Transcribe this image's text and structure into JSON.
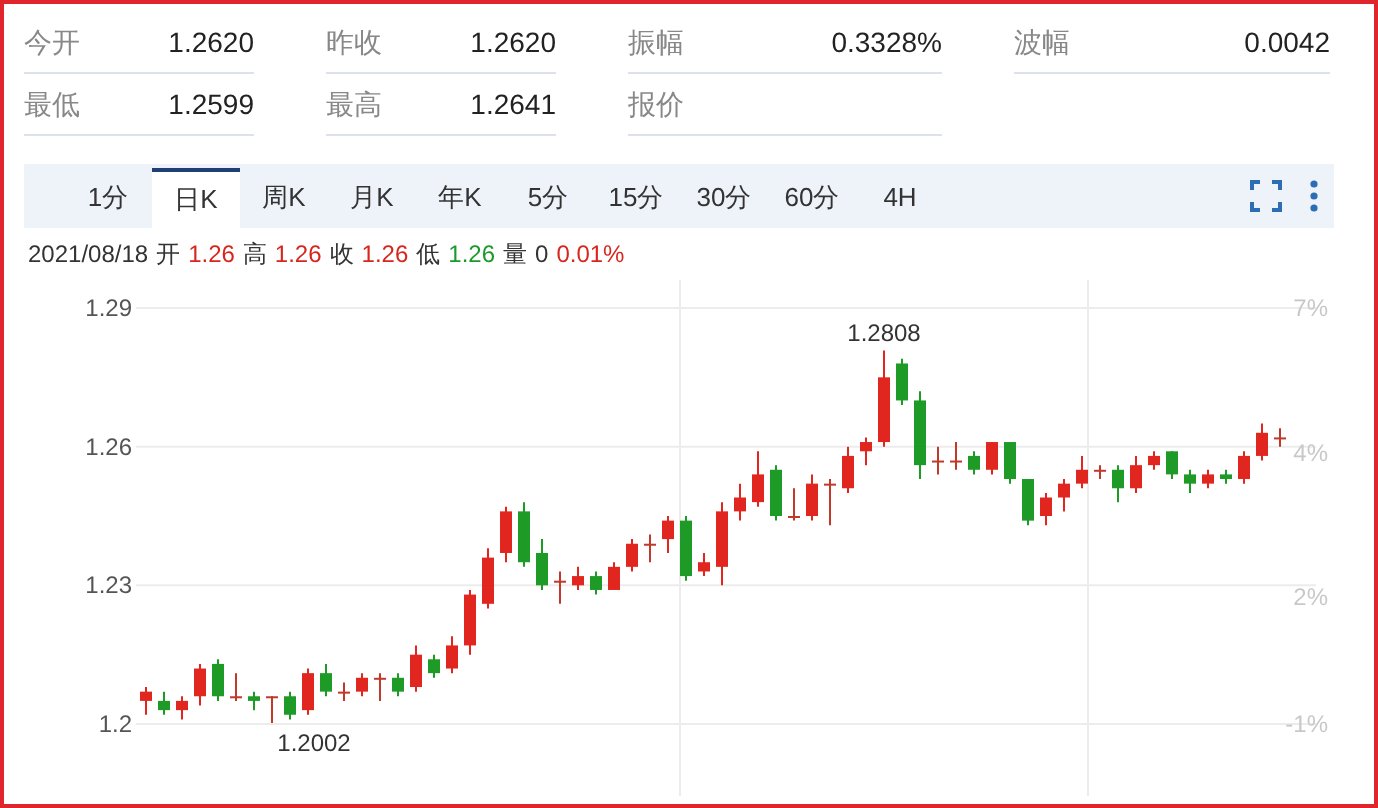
{
  "stats": [
    {
      "label": "今开",
      "value": "1.2620"
    },
    {
      "label": "昨收",
      "value": "1.2620"
    },
    {
      "label": "振幅",
      "value": "0.3328%"
    },
    {
      "label": "波幅",
      "value": "0.0042"
    },
    {
      "label": "最低",
      "value": "1.2599"
    },
    {
      "label": "最高",
      "value": "1.2641"
    },
    {
      "label": "报价"
    }
  ],
  "tabs": [
    {
      "label": "1分",
      "selected": false
    },
    {
      "label": "日K",
      "selected": true
    },
    {
      "label": "周K",
      "selected": false
    },
    {
      "label": "月K",
      "selected": false
    },
    {
      "label": "年K",
      "selected": false
    },
    {
      "label": "5分",
      "selected": false
    },
    {
      "label": "15分",
      "selected": false
    },
    {
      "label": "30分",
      "selected": false
    },
    {
      "label": "60分",
      "selected": false
    },
    {
      "label": "4H",
      "selected": false
    }
  ],
  "quote_line": {
    "date": "2021/08/18",
    "items": [
      {
        "label": "开",
        "value": "1.26",
        "color": "#d7261e"
      },
      {
        "label": "高",
        "value": "1.26",
        "color": "#d7261e"
      },
      {
        "label": "收",
        "value": "1.26",
        "color": "#d7261e"
      },
      {
        "label": "低",
        "value": "1.26",
        "color": "#1a9a2a"
      },
      {
        "label": "量",
        "value": "0",
        "color": "#333333"
      }
    ],
    "change": "0.01%"
  },
  "chart": {
    "percent_labels": [
      "7%",
      "4%",
      "2%",
      "-1%"
    ],
    "high_marker": "1.2808",
    "low_marker": "1.2002",
    "chart_data": {
      "type": "candlestick",
      "ylim": [
        1.2,
        1.29
      ],
      "yticks": [
        {
          "value": 1.29,
          "label": "1.29"
        },
        {
          "value": 1.26,
          "label": "1.26"
        },
        {
          "value": 1.23,
          "label": "1.23"
        },
        {
          "value": 1.2,
          "label": "1.2"
        }
      ],
      "ohlc": [
        [
          1.205,
          1.208,
          1.202,
          1.207
        ],
        [
          1.205,
          1.207,
          1.202,
          1.203
        ],
        [
          1.203,
          1.206,
          1.201,
          1.205
        ],
        [
          1.206,
          1.213,
          1.204,
          1.212
        ],
        [
          1.213,
          1.214,
          1.205,
          1.206
        ],
        [
          1.206,
          1.211,
          1.205,
          1.206
        ],
        [
          1.206,
          1.207,
          1.203,
          1.205
        ],
        [
          1.206,
          1.206,
          1.2002,
          1.206
        ],
        [
          1.206,
          1.207,
          1.201,
          1.202
        ],
        [
          1.203,
          1.212,
          1.202,
          1.211
        ],
        [
          1.211,
          1.213,
          1.206,
          1.207
        ],
        [
          1.207,
          1.209,
          1.205,
          1.207
        ],
        [
          1.207,
          1.211,
          1.206,
          1.21
        ],
        [
          1.21,
          1.211,
          1.205,
          1.21
        ],
        [
          1.21,
          1.211,
          1.206,
          1.207
        ],
        [
          1.208,
          1.217,
          1.207,
          1.215
        ],
        [
          1.214,
          1.215,
          1.21,
          1.211
        ],
        [
          1.212,
          1.219,
          1.211,
          1.217
        ],
        [
          1.217,
          1.229,
          1.215,
          1.228
        ],
        [
          1.226,
          1.238,
          1.225,
          1.236
        ],
        [
          1.237,
          1.247,
          1.235,
          1.246
        ],
        [
          1.246,
          1.248,
          1.234,
          1.235
        ],
        [
          1.237,
          1.24,
          1.229,
          1.23
        ],
        [
          1.231,
          1.233,
          1.226,
          1.231
        ],
        [
          1.23,
          1.234,
          1.229,
          1.232
        ],
        [
          1.232,
          1.233,
          1.228,
          1.229
        ],
        [
          1.229,
          1.235,
          1.229,
          1.234
        ],
        [
          1.234,
          1.24,
          1.233,
          1.239
        ],
        [
          1.239,
          1.241,
          1.235,
          1.239
        ],
        [
          1.24,
          1.245,
          1.237,
          1.244
        ],
        [
          1.244,
          1.245,
          1.231,
          1.232
        ],
        [
          1.233,
          1.237,
          1.232,
          1.235
        ],
        [
          1.234,
          1.248,
          1.23,
          1.246
        ],
        [
          1.246,
          1.252,
          1.244,
          1.249
        ],
        [
          1.248,
          1.259,
          1.247,
          1.254
        ],
        [
          1.255,
          1.256,
          1.244,
          1.245
        ],
        [
          1.245,
          1.251,
          1.244,
          1.245
        ],
        [
          1.245,
          1.254,
          1.244,
          1.252
        ],
        [
          1.252,
          1.253,
          1.243,
          1.252
        ],
        [
          1.251,
          1.26,
          1.25,
          1.258
        ],
        [
          1.259,
          1.262,
          1.256,
          1.261
        ],
        [
          1.261,
          1.2808,
          1.26,
          1.275
        ],
        [
          1.278,
          1.279,
          1.269,
          1.27
        ],
        [
          1.27,
          1.272,
          1.253,
          1.256
        ],
        [
          1.257,
          1.26,
          1.254,
          1.257
        ],
        [
          1.257,
          1.261,
          1.255,
          1.257
        ],
        [
          1.258,
          1.259,
          1.254,
          1.255
        ],
        [
          1.255,
          1.261,
          1.254,
          1.261
        ],
        [
          1.261,
          1.261,
          1.252,
          1.253
        ],
        [
          1.253,
          1.253,
          1.243,
          1.244
        ],
        [
          1.245,
          1.25,
          1.243,
          1.249
        ],
        [
          1.249,
          1.253,
          1.246,
          1.252
        ],
        [
          1.252,
          1.258,
          1.251,
          1.255
        ],
        [
          1.255,
          1.256,
          1.253,
          1.255
        ],
        [
          1.255,
          1.256,
          1.248,
          1.251
        ],
        [
          1.251,
          1.258,
          1.25,
          1.256
        ],
        [
          1.256,
          1.259,
          1.255,
          1.258
        ],
        [
          1.259,
          1.259,
          1.253,
          1.254
        ],
        [
          1.254,
          1.255,
          1.25,
          1.252
        ],
        [
          1.252,
          1.255,
          1.251,
          1.254
        ],
        [
          1.254,
          1.255,
          1.252,
          1.253
        ],
        [
          1.253,
          1.259,
          1.252,
          1.258
        ],
        [
          1.258,
          1.265,
          1.257,
          1.263
        ],
        [
          1.262,
          1.264,
          1.26,
          1.262
        ]
      ]
    }
  }
}
